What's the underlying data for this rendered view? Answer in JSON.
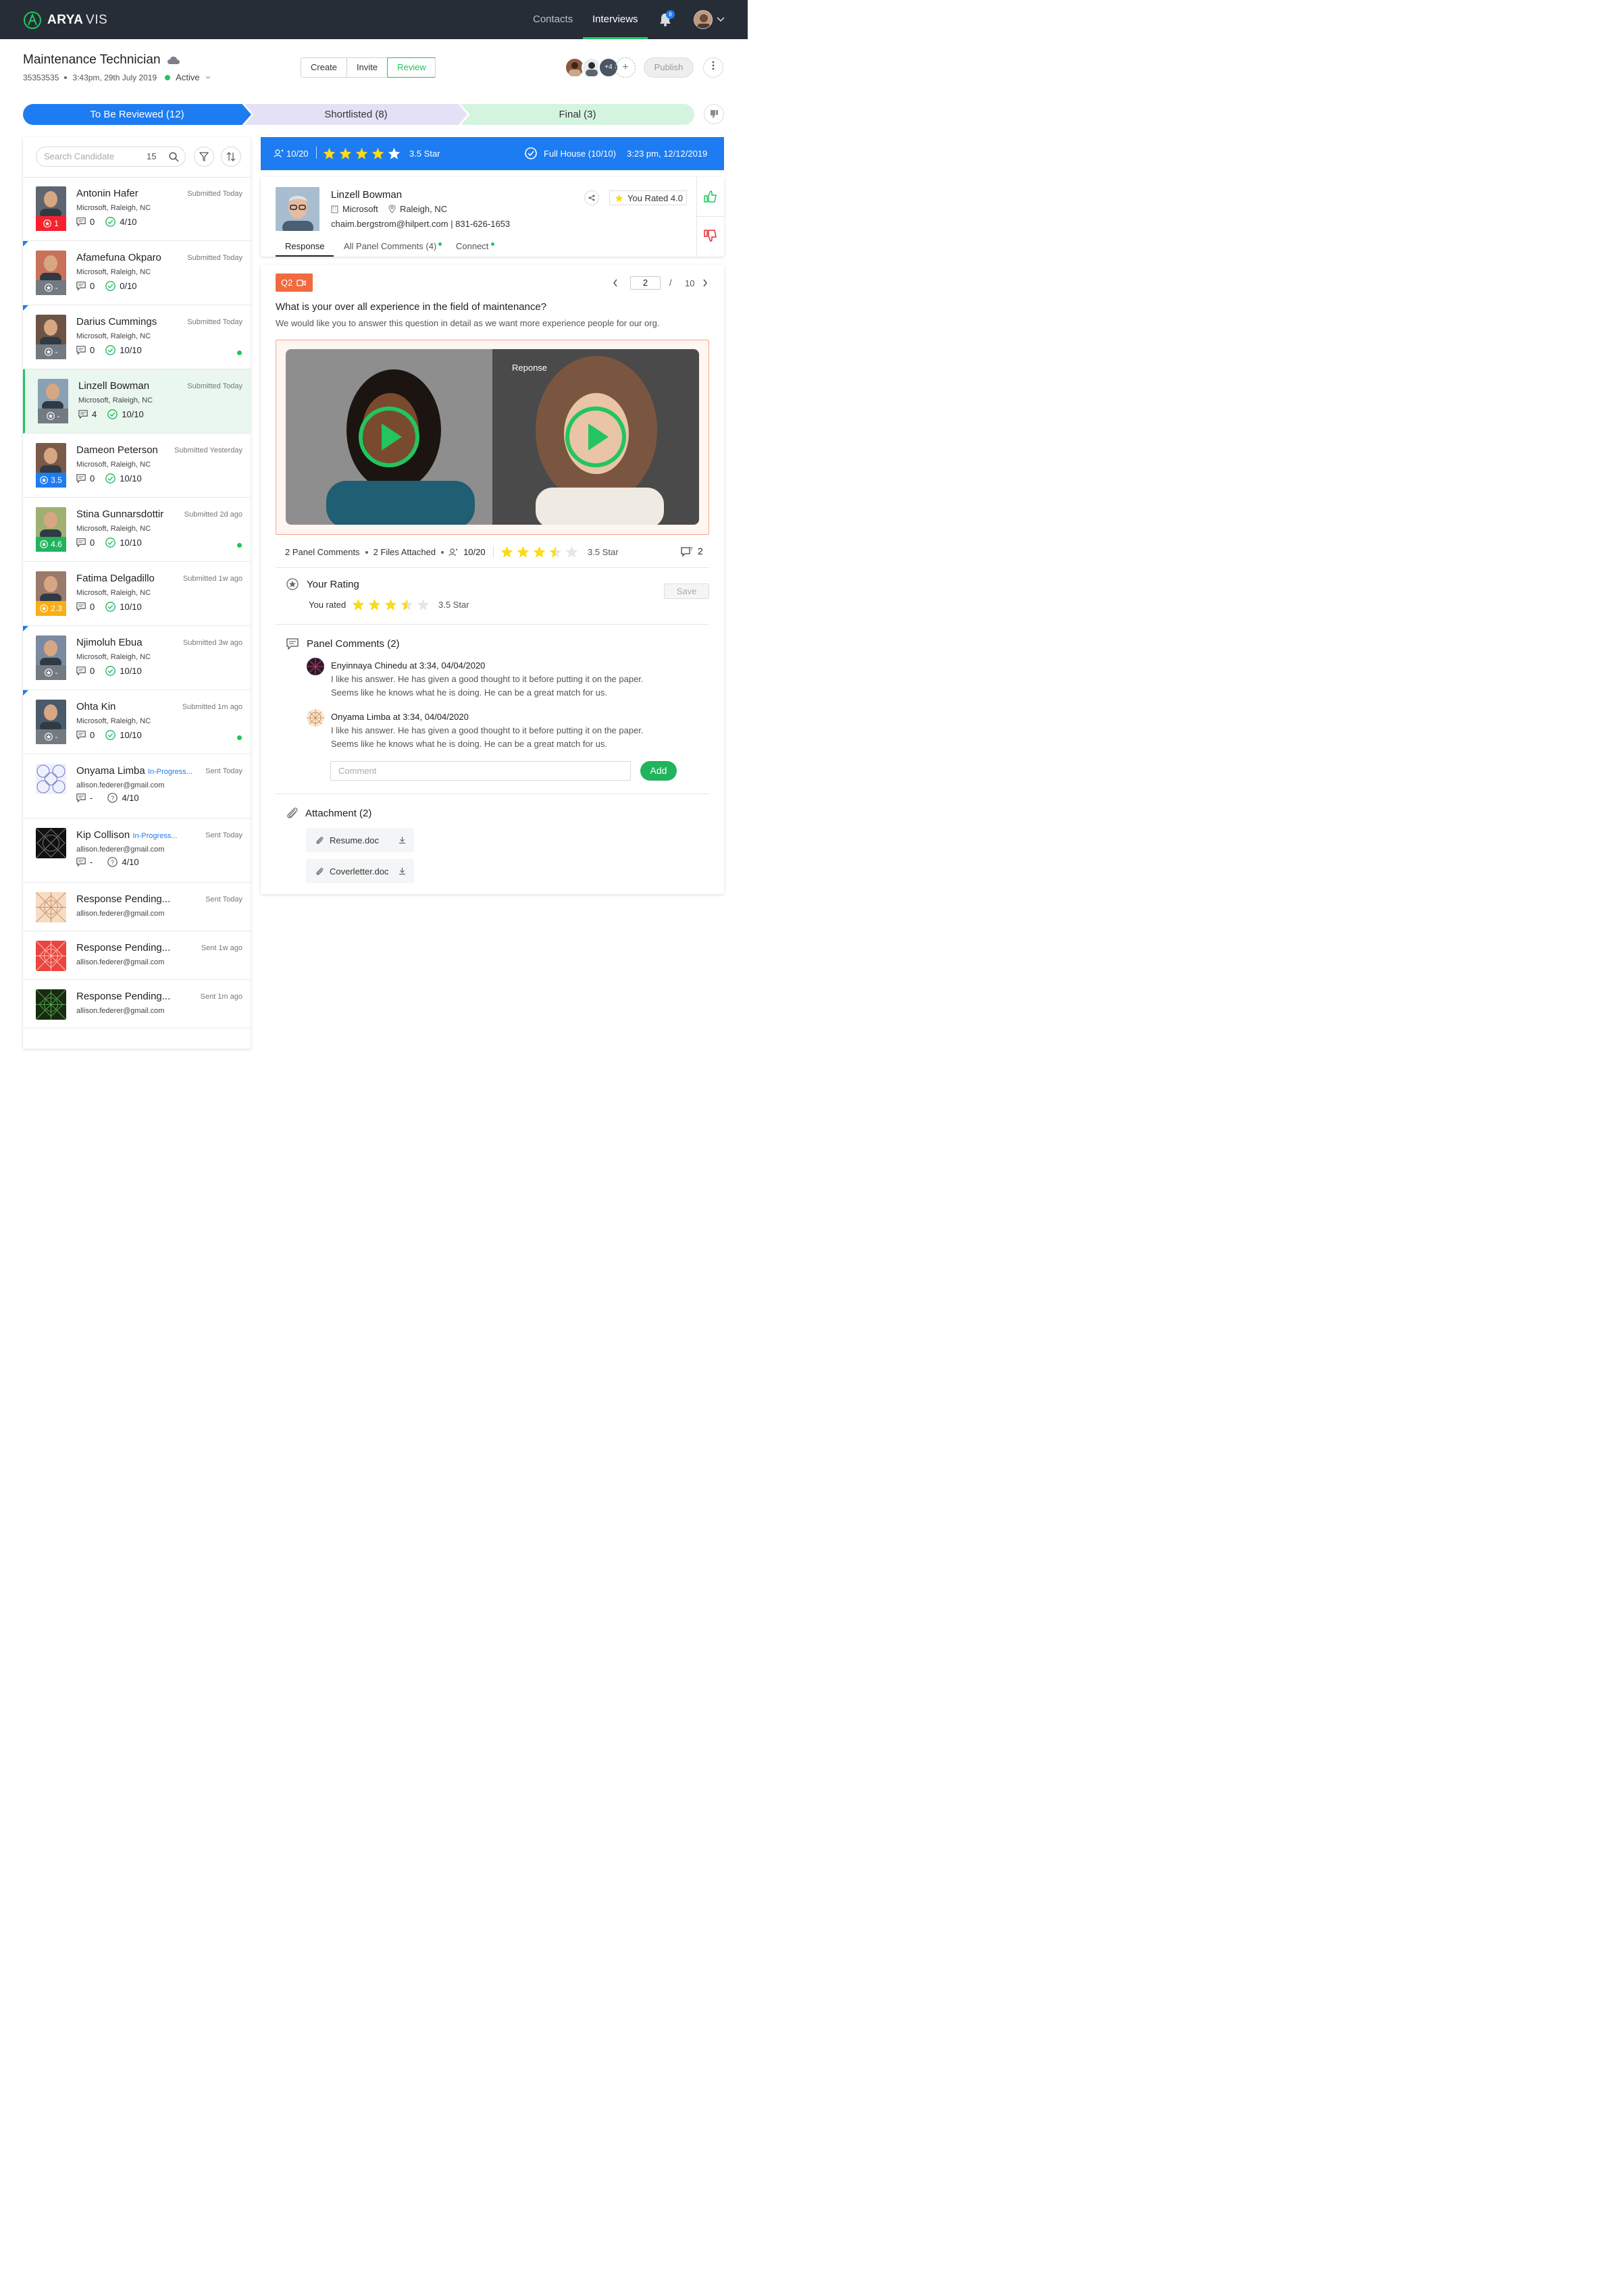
{
  "app": {
    "logo_a": "ARYA",
    "logo_b": "VIS"
  },
  "nav": {
    "contacts": "Contacts",
    "interviews": "Interviews",
    "notifications": "8"
  },
  "job": {
    "title": "Maintenance Technician",
    "id": "35353535",
    "timestamp": "3:43pm, 29th July 2019",
    "status": "Active"
  },
  "actions": {
    "create": "Create",
    "invite": "Invite",
    "review": "Review",
    "panel_more": "+4",
    "publish": "Publish"
  },
  "stages": [
    {
      "label": "To Be Reviewed (12)"
    },
    {
      "label": "Shortlisted (8)"
    },
    {
      "label": "Final (3)"
    }
  ],
  "search": {
    "placeholder": "Search Candidate",
    "count": "15"
  },
  "candidates": [
    {
      "name": "Antonin Hafer",
      "company": "Microsoft, Raleigh, NC",
      "time": "Submitted Today",
      "badge": "1",
      "badge_color": "#f5222d",
      "comments": "0",
      "score": "4/10",
      "dot": false,
      "corner": false
    },
    {
      "name": "Afamefuna Okparo",
      "company": "Microsoft, Raleigh, NC",
      "time": "Submitted Today",
      "badge": "-",
      "badge_color": "#737a82",
      "comments": "0",
      "score": "0/10",
      "dot": false,
      "corner": true
    },
    {
      "name": "Darius Cummings",
      "company": "Microsoft, Raleigh, NC",
      "time": "Submitted Today",
      "badge": "-",
      "badge_color": "#737a82",
      "comments": "0",
      "score": "10/10",
      "dot": true,
      "corner": true
    },
    {
      "name": "Linzell Bowman",
      "company": "Microsoft, Raleigh, NC",
      "time": "Submitted Today",
      "badge": "-",
      "badge_color": "#737a82",
      "comments": "4",
      "score": "10/10",
      "dot": false,
      "corner": false,
      "selected": true
    },
    {
      "name": "Dameon Peterson",
      "company": "Microsoft, Raleigh, NC",
      "time": "Submitted Yesterday",
      "badge": "3.5",
      "badge_color": "#1d7cf2",
      "comments": "0",
      "score": "10/10",
      "dot": false,
      "corner": false
    },
    {
      "name": "Stina Gunnarsdottir",
      "company": "Microsoft, Raleigh, NC",
      "time": "Submitted 2d ago",
      "badge": "4.6",
      "badge_color": "#22b35e",
      "comments": "0",
      "score": "10/10",
      "dot": true,
      "corner": false
    },
    {
      "name": "Fatima Delgadillo",
      "company": "Microsoft, Raleigh, NC",
      "time": "Submitted 1w ago",
      "badge": "2.3",
      "badge_color": "#faad14",
      "comments": "0",
      "score": "10/10",
      "dot": false,
      "corner": false
    },
    {
      "name": "Njimoluh Ebua",
      "company": "Microsoft, Raleigh, NC",
      "time": "Submitted 3w ago",
      "badge": "-",
      "badge_color": "#737a82",
      "comments": "0",
      "score": "10/10",
      "dot": false,
      "corner": true
    },
    {
      "name": "Ohta Kin",
      "company": "Microsoft, Raleigh, NC",
      "time": "Submitted 1m ago",
      "badge": "-",
      "badge_color": "#737a82",
      "comments": "0",
      "score": "10/10",
      "dot": true,
      "corner": true
    }
  ],
  "invited": [
    {
      "name": "Onyama Limba",
      "status": "In-Progress...",
      "email": "allison.federer@gmail.com",
      "time": "Sent Today",
      "comments": "-",
      "score": "4/10"
    },
    {
      "name": "Kip Collison",
      "status": "In-Progress...",
      "email": "allison.federer@gmail.com",
      "time": "Sent Today",
      "comments": "-",
      "score": "4/10"
    }
  ],
  "pending": [
    {
      "name": "Response Pending...",
      "email": "allison.federer@gmail.com",
      "time": "Sent Today",
      "color": "#f7dcc4"
    },
    {
      "name": "Response Pending...",
      "email": "allison.federer@gmail.com",
      "time": "Sent 1w ago",
      "color": "#e8463f"
    },
    {
      "name": "Response Pending...",
      "email": "allison.federer@gmail.com",
      "time": "Sent 1m ago",
      "color": "#1a2a12"
    }
  ],
  "banner": {
    "score": "10/20",
    "rating": "3.5 Star",
    "rating_value": 3.5,
    "full_house": "Full House (10/10)",
    "datetime": "3:23 pm, 12/12/2019"
  },
  "profile": {
    "name": "Linzell Bowman",
    "company": "Microsoft",
    "location": "Raleigh, NC",
    "contact": "chaim.bergstrom@hilpert.com | 831-626-1653",
    "you_rated": "You Rated 4.0",
    "tabs": [
      "Response",
      "All Panel Comments (4)",
      "Connect"
    ]
  },
  "question": {
    "tag": "Q2",
    "current": "2",
    "sep": "/",
    "total": "10",
    "title": "What is your over all experience in the field of maintenance?",
    "desc": "We would like you to answer this question in detail as we want more experience people for our org.",
    "video_label": "Reponse"
  },
  "summary": {
    "panel_comments": "2 Panel Comments",
    "files": "2 Files Attached",
    "score": "10/20",
    "rating": "3.5 Star",
    "rating_value": 3.5,
    "comment_count": "2"
  },
  "your_rating": {
    "title": "Your Rating",
    "label": "You rated",
    "rating": "3.5 Star",
    "rating_value": 3.5,
    "save": "Save"
  },
  "panel_comments": {
    "title": "Panel Comments (2)",
    "items": [
      {
        "author": "Enyinnaya Chinedu at 3:34, 04/04/2020",
        "line1": "I like his answer. He has given a good thought to it before putting it on the paper.",
        "line2": "Seems like he knows what he is doing. He can be a great match for us."
      },
      {
        "author": "Onyama Limba at 3:34, 04/04/2020",
        "line1": "I like his answer. He has given a good thought to it before putting it on the paper.",
        "line2": "Seems like he knows what he is doing. He can be a great match for us."
      }
    ],
    "placeholder": "Comment",
    "add": "Add"
  },
  "attachments": {
    "title": "Attachment (2)",
    "files": [
      "Resume.doc",
      "Coverletter.doc"
    ]
  },
  "colors": {
    "nav_bg": "#262d37",
    "accent_blue": "#1d7cf2",
    "accent_green": "#22c55e",
    "star": "#fadb14"
  }
}
